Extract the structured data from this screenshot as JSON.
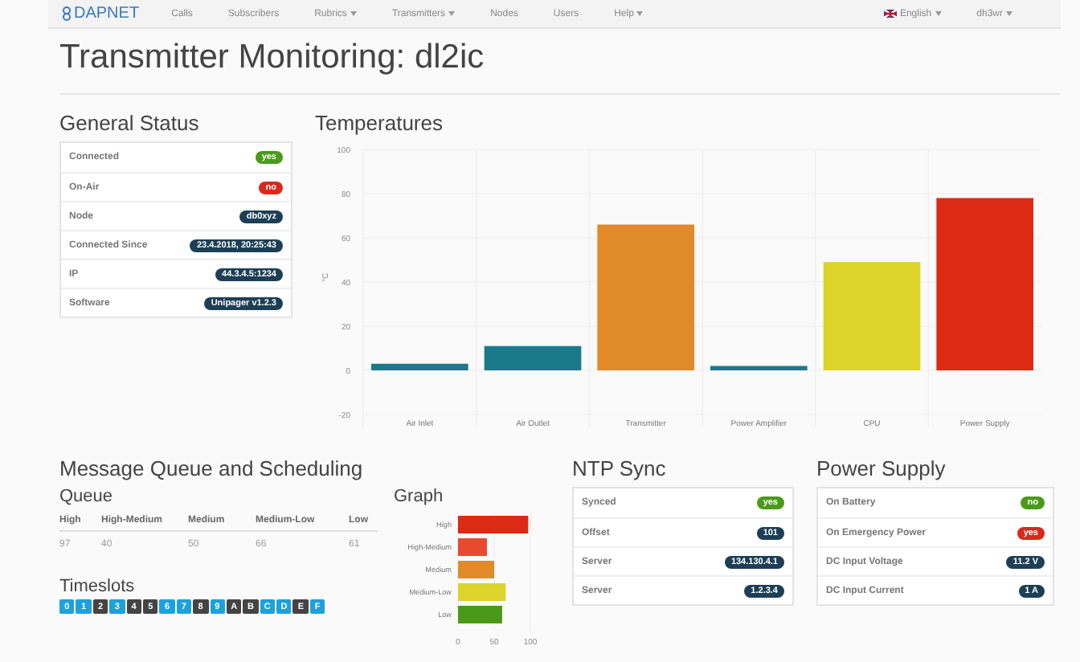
{
  "navbar": {
    "brand": "DAPNET",
    "items": [
      {
        "label": "Calls",
        "dropdown": false
      },
      {
        "label": "Subscribers",
        "dropdown": false
      },
      {
        "label": "Rubrics",
        "dropdown": true
      },
      {
        "label": "Transmitters",
        "dropdown": true
      },
      {
        "label": "Nodes",
        "dropdown": false
      },
      {
        "label": "Users",
        "dropdown": false
      },
      {
        "label": "Help",
        "dropdown": true
      }
    ],
    "right": [
      {
        "label": "English",
        "dropdown": true,
        "flag": true
      },
      {
        "label": "dh3wr",
        "dropdown": true,
        "flag": false
      }
    ]
  },
  "page_title": "Transmitter Monitoring: dl2ic",
  "general_status": {
    "title": "General Status",
    "rows": [
      {
        "label": "Connected",
        "value": "yes",
        "kind": "success"
      },
      {
        "label": "On-Air",
        "value": "no",
        "kind": "danger"
      },
      {
        "label": "Node",
        "value": "db0xyz",
        "kind": "info"
      },
      {
        "label": "Connected Since",
        "value": "23.4.2018, 20:25:43",
        "kind": "info"
      },
      {
        "label": "IP",
        "value": "44.3.4.5:1234",
        "kind": "info"
      },
      {
        "label": "Software",
        "value": "Unipager v1.2.3",
        "kind": "info"
      }
    ]
  },
  "temperatures": {
    "title": "Temperatures",
    "chart_data": {
      "type": "bar",
      "ylabel": "°C",
      "categories": [
        "Air Inlet",
        "Air Outlet",
        "Transmitter",
        "Power Amplifier",
        "CPU",
        "Power Supply"
      ],
      "series": [
        {
          "values": [
            3,
            11,
            66,
            2,
            49,
            78
          ]
        }
      ],
      "grid": true,
      "colors": [
        "#1a7a8c",
        "#1a7a8c",
        "#e08a2a",
        "#1a7a8c",
        "#dcd42a",
        "#dc2a14"
      ],
      "ylim": [
        -20,
        100
      ],
      "yticks": [
        -20,
        0,
        20,
        40,
        60,
        80,
        100
      ]
    }
  },
  "message_queue": {
    "title": "Message Queue and Scheduling",
    "queue": {
      "title": "Queue",
      "columns": [
        "High",
        "High-Medium",
        "Medium",
        "Medium-Low",
        "Low"
      ],
      "values": [
        "97",
        "40",
        "50",
        "66",
        "61"
      ]
    },
    "timeslots": {
      "title": "Timeslots",
      "slots": [
        {
          "label": "0",
          "active": true
        },
        {
          "label": "1",
          "active": true
        },
        {
          "label": "2",
          "active": false
        },
        {
          "label": "3",
          "active": true
        },
        {
          "label": "4",
          "active": false
        },
        {
          "label": "5",
          "active": false
        },
        {
          "label": "6",
          "active": true
        },
        {
          "label": "7",
          "active": true
        },
        {
          "label": "8",
          "active": false
        },
        {
          "label": "9",
          "active": true
        },
        {
          "label": "A",
          "active": false
        },
        {
          "label": "B",
          "active": false
        },
        {
          "label": "C",
          "active": true
        },
        {
          "label": "D",
          "active": true
        },
        {
          "label": "E",
          "active": false
        },
        {
          "label": "F",
          "active": true
        }
      ]
    },
    "graph": {
      "title": "Graph",
      "chart_data": {
        "type": "bar",
        "orientation": "horizontal",
        "categories": [
          "High",
          "High-Medium",
          "Medium",
          "Medium-Low",
          "Low"
        ],
        "series": [
          {
            "values": [
              97,
              40,
              50,
              66,
              61
            ]
          }
        ],
        "grid": true,
        "colors": [
          "#dc2a14",
          "#e84a30",
          "#e08a2a",
          "#dcd42a",
          "#4a9a1a"
        ],
        "xlim": [
          0,
          100
        ],
        "xticks": [
          0,
          50,
          100
        ]
      }
    }
  },
  "ntp_sync": {
    "title": "NTP Sync",
    "rows": [
      {
        "label": "Synced",
        "value": "yes",
        "kind": "success"
      },
      {
        "label": "Offset",
        "value": "101",
        "kind": "info"
      },
      {
        "label": "Server",
        "value": "134.130.4.1",
        "kind": "info"
      },
      {
        "label": "Server",
        "value": "1.2.3.4",
        "kind": "info"
      }
    ]
  },
  "power_supply": {
    "title": "Power Supply",
    "rows": [
      {
        "label": "On Battery",
        "value": "no",
        "kind": "success"
      },
      {
        "label": "On Emergency Power",
        "value": "yes",
        "kind": "danger"
      },
      {
        "label": "DC Input Voltage",
        "value": "11.2 V",
        "kind": "info"
      },
      {
        "label": "DC Input Current",
        "value": "1 A",
        "kind": "info"
      }
    ]
  }
}
